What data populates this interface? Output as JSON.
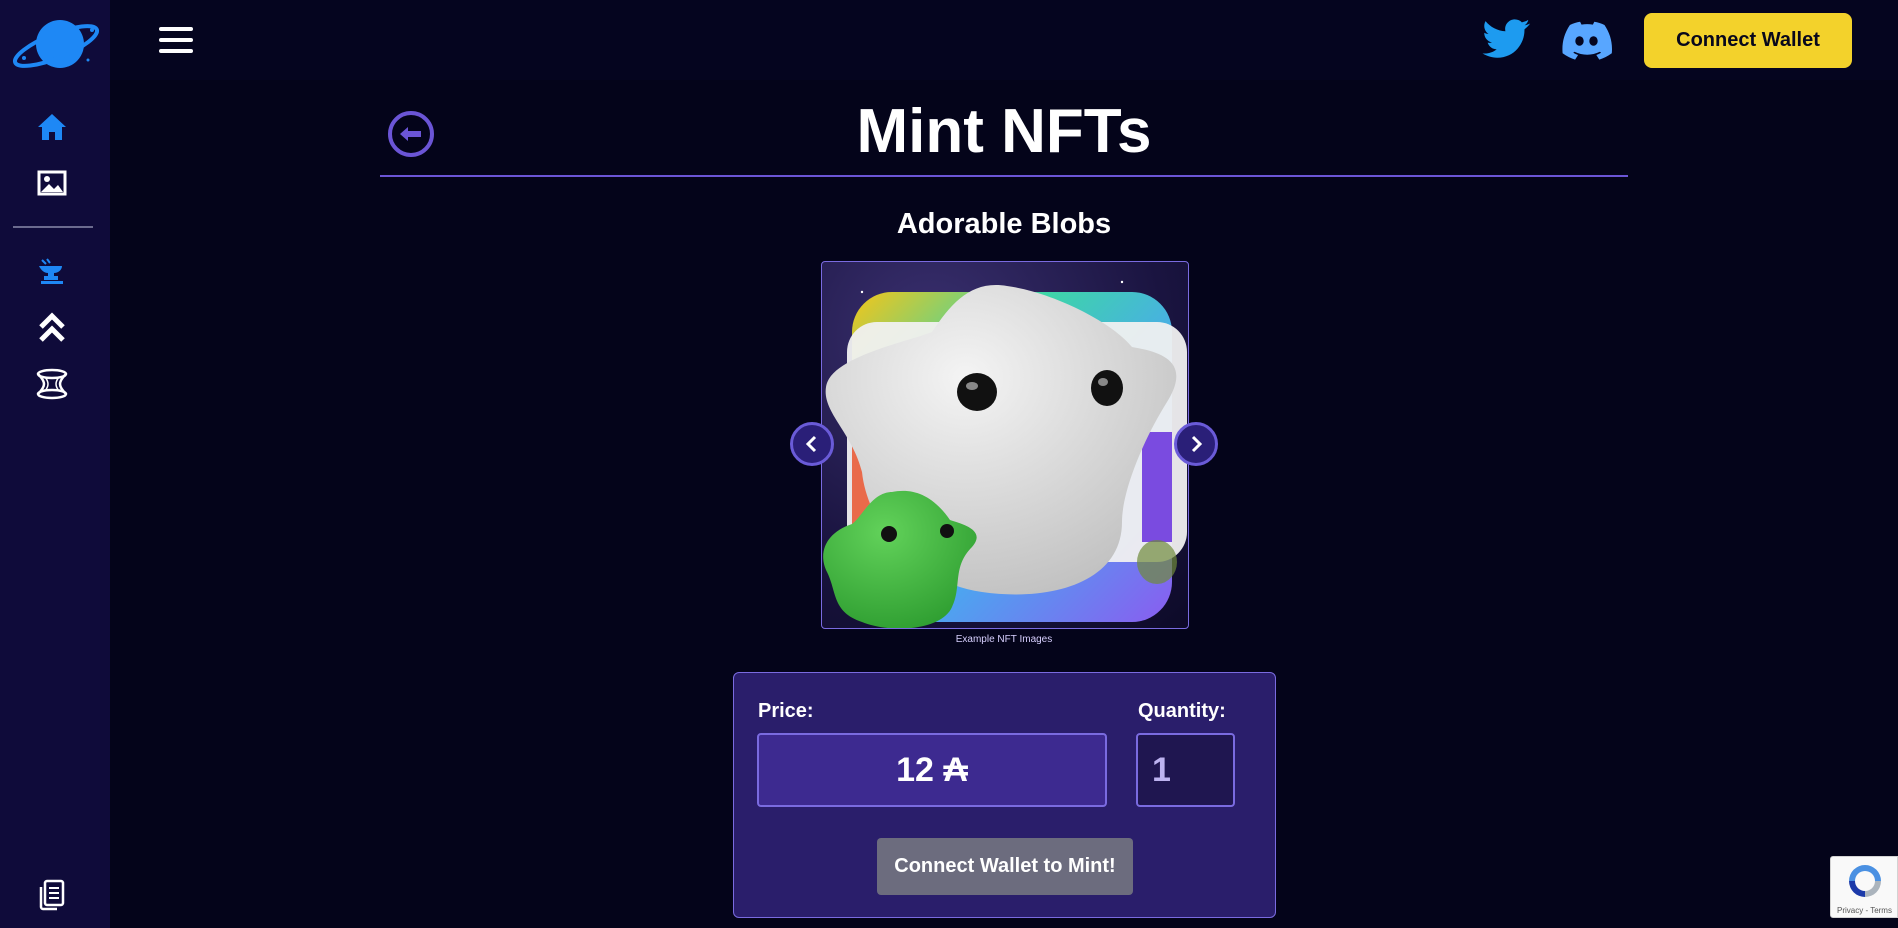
{
  "header": {
    "connect_label": "Connect Wallet"
  },
  "page": {
    "title": "Mint NFTs",
    "collection_name": "Adorable Blobs",
    "gallery_caption": "Example NFT Images"
  },
  "mint": {
    "price_label": "Price:",
    "price_value": "12 ₳",
    "quantity_label": "Quantity:",
    "quantity_value": "1",
    "mint_button_label": "Connect Wallet to Mint!"
  },
  "recaptcha": {
    "footer_text": "Privacy - Terms"
  },
  "sidebar": {
    "items": [
      {
        "icon": "home-icon"
      },
      {
        "icon": "image-icon"
      },
      {
        "icon": "anvil-icon"
      },
      {
        "icon": "chevrons-up-icon"
      },
      {
        "icon": "wormhole-icon"
      },
      {
        "icon": "documents-icon"
      }
    ]
  },
  "colors": {
    "accent": "#6b55d6",
    "brand_yellow": "#f3d22b",
    "twitter_blue": "#1d9bf0",
    "sidebar_bg": "#0f0b3a",
    "page_bg": "#04041a"
  }
}
